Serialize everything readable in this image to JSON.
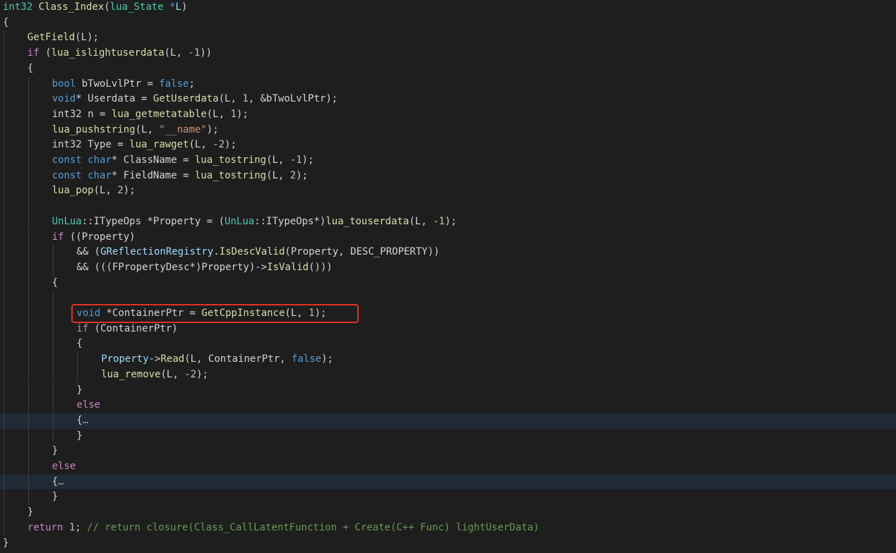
{
  "editor": {
    "language": "C++",
    "theme_colors": {
      "background": "#1e1e1e",
      "folded_line_background": "#1f2a35",
      "highlight_box": "#e03224",
      "keyword": "#569cd6",
      "type": "#4ec9b0",
      "function": "#dcdcaa",
      "variable": "#9cdcfe",
      "number": "#b5cea8",
      "string": "#ce9178",
      "control": "#c586c0",
      "comment": "#6a9955",
      "plain": "#d4d4d4"
    },
    "highlighted_line": 20,
    "folded_lines": [
      27,
      31
    ],
    "lines": [
      {
        "indent": 0,
        "tokens": [
          {
            "t": "int32",
            "c": "ty"
          },
          {
            "t": " ",
            "c": "pl"
          },
          {
            "t": "Class_Index",
            "c": "fn"
          },
          {
            "t": "(",
            "c": "pl"
          },
          {
            "t": "lua_State",
            "c": "ty"
          },
          {
            "t": " ",
            "c": "pl"
          },
          {
            "t": "*",
            "c": "kw"
          },
          {
            "t": "L",
            "c": "va"
          },
          {
            "t": ")",
            "c": "pl"
          }
        ]
      },
      {
        "indent": 0,
        "tokens": [
          {
            "t": "{",
            "c": "pl"
          }
        ]
      },
      {
        "indent": 1,
        "tokens": [
          {
            "t": "GetField",
            "c": "fn"
          },
          {
            "t": "(L);",
            "c": "pl"
          }
        ]
      },
      {
        "indent": 1,
        "tokens": [
          {
            "t": "if",
            "c": "ct"
          },
          {
            "t": " (",
            "c": "pl"
          },
          {
            "t": "lua_islightuserdata",
            "c": "fn"
          },
          {
            "t": "(L, ",
            "c": "pl"
          },
          {
            "t": "-1",
            "c": "nu"
          },
          {
            "t": "))",
            "c": "pl"
          }
        ]
      },
      {
        "indent": 1,
        "tokens": [
          {
            "t": "{",
            "c": "pl"
          }
        ]
      },
      {
        "indent": 2,
        "tokens": [
          {
            "t": "bool",
            "c": "kw"
          },
          {
            "t": " bTwoLvlPtr = ",
            "c": "pl"
          },
          {
            "t": "false",
            "c": "kw"
          },
          {
            "t": ";",
            "c": "pl"
          }
        ]
      },
      {
        "indent": 2,
        "tokens": [
          {
            "t": "void",
            "c": "kw"
          },
          {
            "t": "* Userdata = ",
            "c": "pl"
          },
          {
            "t": "GetUserdata",
            "c": "fn"
          },
          {
            "t": "(L, ",
            "c": "pl"
          },
          {
            "t": "1",
            "c": "nu"
          },
          {
            "t": ", &bTwoLvlPtr);",
            "c": "pl"
          }
        ]
      },
      {
        "indent": 2,
        "tokens": [
          {
            "t": "int32 n = ",
            "c": "pl"
          },
          {
            "t": "lua_getmetatable",
            "c": "fn"
          },
          {
            "t": "(L, ",
            "c": "pl"
          },
          {
            "t": "1",
            "c": "nu"
          },
          {
            "t": ");",
            "c": "pl"
          }
        ]
      },
      {
        "indent": 2,
        "tokens": [
          {
            "t": "lua_pushstring",
            "c": "fn"
          },
          {
            "t": "(L, ",
            "c": "pl"
          },
          {
            "t": "\"__name\"",
            "c": "st"
          },
          {
            "t": ");",
            "c": "pl"
          }
        ]
      },
      {
        "indent": 2,
        "tokens": [
          {
            "t": "int32 Type = ",
            "c": "pl"
          },
          {
            "t": "lua_rawget",
            "c": "fn"
          },
          {
            "t": "(L, ",
            "c": "pl"
          },
          {
            "t": "-2",
            "c": "nu"
          },
          {
            "t": ");",
            "c": "pl"
          }
        ]
      },
      {
        "indent": 2,
        "tokens": [
          {
            "t": "const",
            "c": "kw"
          },
          {
            "t": " ",
            "c": "pl"
          },
          {
            "t": "char",
            "c": "kw"
          },
          {
            "t": "* ClassName = ",
            "c": "pl"
          },
          {
            "t": "lua_tostring",
            "c": "fn"
          },
          {
            "t": "(L, ",
            "c": "pl"
          },
          {
            "t": "-1",
            "c": "nu"
          },
          {
            "t": ");",
            "c": "pl"
          }
        ]
      },
      {
        "indent": 2,
        "tokens": [
          {
            "t": "const",
            "c": "kw"
          },
          {
            "t": " ",
            "c": "pl"
          },
          {
            "t": "char",
            "c": "kw"
          },
          {
            "t": "* FieldName = ",
            "c": "pl"
          },
          {
            "t": "lua_tostring",
            "c": "fn"
          },
          {
            "t": "(L, ",
            "c": "pl"
          },
          {
            "t": "2",
            "c": "nu"
          },
          {
            "t": ");",
            "c": "pl"
          }
        ]
      },
      {
        "indent": 2,
        "tokens": [
          {
            "t": "lua_pop",
            "c": "fn"
          },
          {
            "t": "(L, ",
            "c": "pl"
          },
          {
            "t": "2",
            "c": "nu"
          },
          {
            "t": ");",
            "c": "pl"
          }
        ]
      },
      {
        "indent": 0,
        "tokens": []
      },
      {
        "indent": 2,
        "tokens": [
          {
            "t": "UnLua",
            "c": "ty"
          },
          {
            "t": "::ITypeOps *Property = (",
            "c": "pl"
          },
          {
            "t": "UnLua",
            "c": "ty"
          },
          {
            "t": "::ITypeOps*)",
            "c": "pl"
          },
          {
            "t": "lua_touserdata",
            "c": "fn"
          },
          {
            "t": "(L, ",
            "c": "pl"
          },
          {
            "t": "-1",
            "c": "nu"
          },
          {
            "t": ");",
            "c": "pl"
          }
        ]
      },
      {
        "indent": 2,
        "tokens": [
          {
            "t": "if",
            "c": "ct"
          },
          {
            "t": " ((Property)",
            "c": "pl"
          }
        ]
      },
      {
        "indent": 3,
        "tokens": [
          {
            "t": "&& (",
            "c": "pl"
          },
          {
            "t": "GReflectionRegistry",
            "c": "va"
          },
          {
            "t": ".",
            "c": "pl"
          },
          {
            "t": "IsDescValid",
            "c": "fn"
          },
          {
            "t": "(Property, DESC_PROPERTY))",
            "c": "pl"
          }
        ]
      },
      {
        "indent": 3,
        "tokens": [
          {
            "t": "&& (((FPropertyDesc*)Property)->",
            "c": "pl"
          },
          {
            "t": "IsValid",
            "c": "fn"
          },
          {
            "t": "()))",
            "c": "pl"
          }
        ]
      },
      {
        "indent": 2,
        "tokens": [
          {
            "t": "{",
            "c": "pl"
          }
        ]
      },
      {
        "indent": 0,
        "tokens": []
      },
      {
        "indent": 3,
        "tokens": [
          {
            "t": "void",
            "c": "kw"
          },
          {
            "t": " *ContainerPtr = ",
            "c": "pl"
          },
          {
            "t": "GetCppInstance",
            "c": "fn"
          },
          {
            "t": "(L, ",
            "c": "pl"
          },
          {
            "t": "1",
            "c": "nu"
          },
          {
            "t": ");",
            "c": "pl"
          }
        ]
      },
      {
        "indent": 3,
        "tokens": [
          {
            "t": "if",
            "c": "ct"
          },
          {
            "t": " (ContainerPtr)",
            "c": "pl"
          }
        ]
      },
      {
        "indent": 3,
        "tokens": [
          {
            "t": "{",
            "c": "pl"
          }
        ]
      },
      {
        "indent": 4,
        "tokens": [
          {
            "t": "Property",
            "c": "va"
          },
          {
            "t": "->",
            "c": "pl"
          },
          {
            "t": "Read",
            "c": "fn"
          },
          {
            "t": "(L, ContainerPtr, ",
            "c": "pl"
          },
          {
            "t": "false",
            "c": "kw"
          },
          {
            "t": ");",
            "c": "pl"
          }
        ]
      },
      {
        "indent": 4,
        "tokens": [
          {
            "t": "lua_remove",
            "c": "fn"
          },
          {
            "t": "(L, ",
            "c": "pl"
          },
          {
            "t": "-2",
            "c": "nu"
          },
          {
            "t": ");",
            "c": "pl"
          }
        ]
      },
      {
        "indent": 3,
        "tokens": [
          {
            "t": "}",
            "c": "pl"
          }
        ]
      },
      {
        "indent": 3,
        "tokens": [
          {
            "t": "else",
            "c": "ct"
          }
        ]
      },
      {
        "indent": 3,
        "tokens": [
          {
            "t": "{",
            "c": "pl"
          },
          {
            "t": "…",
            "c": "fd"
          }
        ]
      },
      {
        "indent": 3,
        "tokens": [
          {
            "t": "}",
            "c": "pl"
          }
        ]
      },
      {
        "indent": 2,
        "tokens": [
          {
            "t": "}",
            "c": "pl"
          }
        ]
      },
      {
        "indent": 2,
        "tokens": [
          {
            "t": "else",
            "c": "ct"
          }
        ]
      },
      {
        "indent": 2,
        "tokens": [
          {
            "t": "{",
            "c": "pl"
          },
          {
            "t": "…",
            "c": "fd"
          }
        ]
      },
      {
        "indent": 2,
        "tokens": [
          {
            "t": "}",
            "c": "pl"
          }
        ]
      },
      {
        "indent": 1,
        "tokens": [
          {
            "t": "}",
            "c": "pl"
          }
        ]
      },
      {
        "indent": 1,
        "tokens": [
          {
            "t": "return",
            "c": "ct"
          },
          {
            "t": " ",
            "c": "pl"
          },
          {
            "t": "1",
            "c": "nu"
          },
          {
            "t": "; ",
            "c": "pl"
          },
          {
            "t": "// return closure(Class_CallLatentFunction + Create(C++ Func) lightUserData)",
            "c": "cm"
          }
        ]
      },
      {
        "indent": 0,
        "tokens": [
          {
            "t": "}",
            "c": "pl"
          }
        ]
      }
    ]
  }
}
